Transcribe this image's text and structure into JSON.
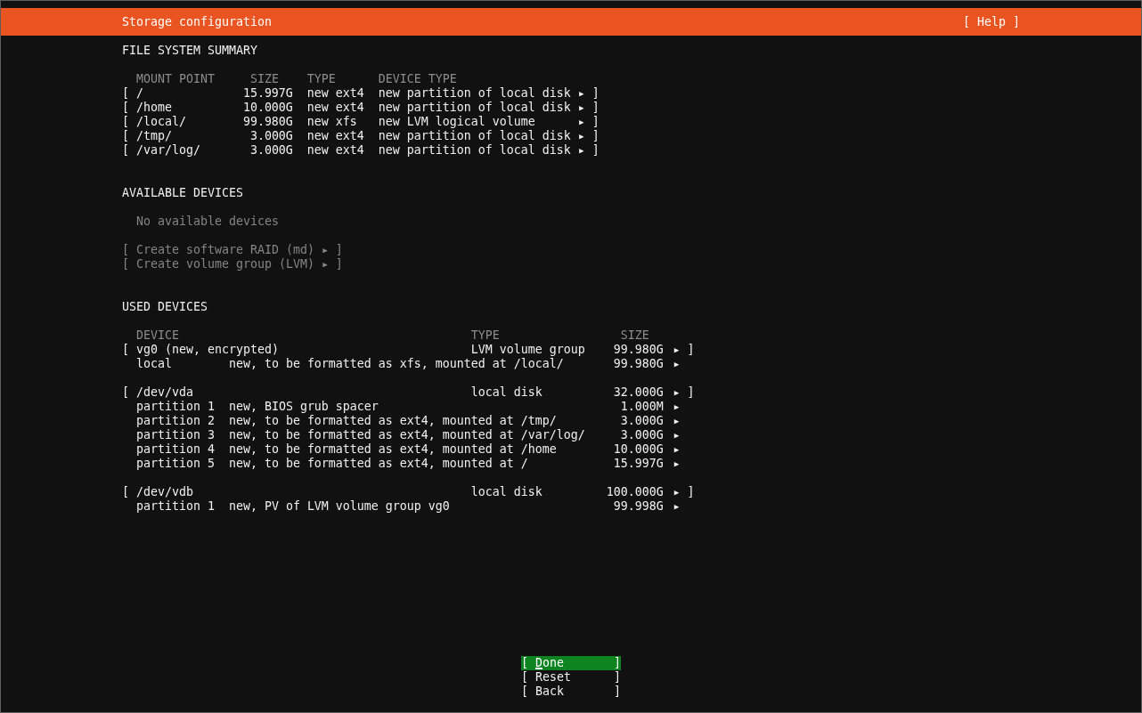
{
  "header": {
    "title": "Storage configuration",
    "help": {
      "open": "[",
      "label": "Help",
      "close": "]"
    }
  },
  "file_system_summary": {
    "title": "FILE SYSTEM SUMMARY",
    "columns": [
      "MOUNT POINT",
      "SIZE",
      "TYPE",
      "DEVICE TYPE"
    ],
    "rows": [
      {
        "open": "[",
        "mount_point": "/",
        "size": "15.997G",
        "type": "new ext4",
        "device_type": "new partition of local disk",
        "arrow": "▶",
        "close": "]"
      },
      {
        "open": "[",
        "mount_point": "/home",
        "size": "10.000G",
        "type": "new ext4",
        "device_type": "new partition of local disk",
        "arrow": "▶",
        "close": "]"
      },
      {
        "open": "[",
        "mount_point": "/local/",
        "size": "99.980G",
        "type": "new xfs",
        "device_type": "new LVM logical volume",
        "arrow": "▶",
        "close": "]"
      },
      {
        "open": "[",
        "mount_point": "/tmp/",
        "size": "3.000G",
        "type": "new ext4",
        "device_type": "new partition of local disk",
        "arrow": "▶",
        "close": "]"
      },
      {
        "open": "[",
        "mount_point": "/var/log/",
        "size": "3.000G",
        "type": "new ext4",
        "device_type": "new partition of local disk",
        "arrow": "▶",
        "close": "]"
      }
    ]
  },
  "available_devices": {
    "title": "AVAILABLE DEVICES",
    "empty_message": "No available devices",
    "actions": [
      {
        "open": "[",
        "label": "Create software RAID (md)",
        "arrow": "▶",
        "close": "]",
        "disabled": true
      },
      {
        "open": "[",
        "label": "Create volume group (LVM)",
        "arrow": "▶",
        "close": "]",
        "disabled": true
      }
    ]
  },
  "used_devices": {
    "title": "USED DEVICES",
    "columns": [
      "DEVICE",
      "TYPE",
      "SIZE"
    ],
    "devices": [
      {
        "open": "[",
        "device": "vg0 (new, encrypted)",
        "type": "LVM volume group",
        "size": "99.980G",
        "arrow": "▶",
        "close": "]",
        "children": [
          {
            "name": "local",
            "description": "new, to be formatted as xfs, mounted at /local/",
            "size": "99.980G",
            "arrow": "▶"
          }
        ]
      },
      {
        "open": "[",
        "device": "/dev/vda",
        "type": "local disk",
        "size": "32.000G",
        "arrow": "▶",
        "close": "]",
        "children": [
          {
            "name": "partition 1",
            "description": "new, BIOS grub spacer",
            "size": "1.000M",
            "arrow": "▶"
          },
          {
            "name": "partition 2",
            "description": "new, to be formatted as ext4, mounted at /tmp/",
            "size": "3.000G",
            "arrow": "▶"
          },
          {
            "name": "partition 3",
            "description": "new, to be formatted as ext4, mounted at /var/log/",
            "size": "3.000G",
            "arrow": "▶"
          },
          {
            "name": "partition 4",
            "description": "new, to be formatted as ext4, mounted at /home",
            "size": "10.000G",
            "arrow": "▶"
          },
          {
            "name": "partition 5",
            "description": "new, to be formatted as ext4, mounted at /",
            "size": "15.997G",
            "arrow": "▶"
          }
        ]
      },
      {
        "open": "[",
        "device": "/dev/vdb",
        "type": "local disk",
        "size": "100.000G",
        "arrow": "▶",
        "close": "]",
        "children": [
          {
            "name": "partition 1",
            "description": "new, PV of LVM volume group vg0",
            "size": "99.998G",
            "arrow": "▶"
          }
        ]
      }
    ]
  },
  "buttons": [
    {
      "open": "[",
      "label": "Done",
      "close": "]",
      "selected": true
    },
    {
      "open": "[",
      "label": "Reset",
      "close": "]",
      "selected": false
    },
    {
      "open": "[",
      "label": "Back",
      "close": "]",
      "selected": false
    }
  ]
}
